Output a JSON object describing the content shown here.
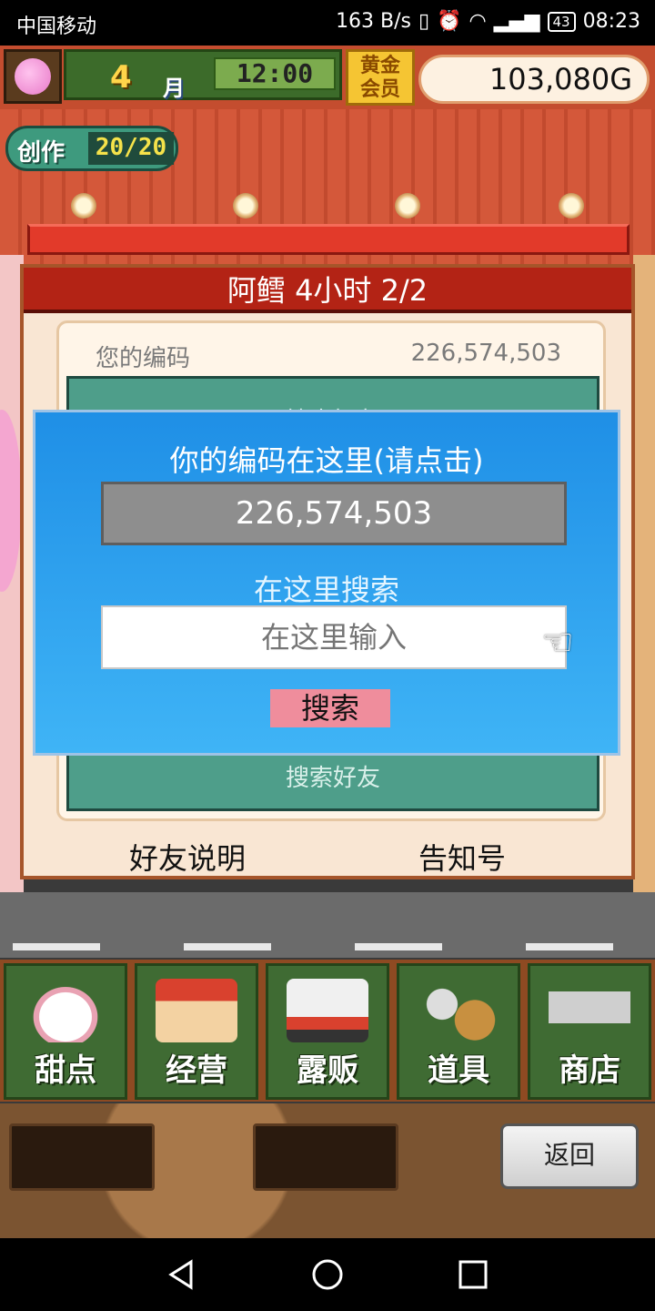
{
  "status_bar": {
    "carrier": "中国移动",
    "speed": "163 B/s",
    "battery": "43",
    "time": "08:23"
  },
  "hud": {
    "month_number": "4",
    "month_label": "月",
    "clock": "12:00",
    "gold_badge_line1": "黄金",
    "gold_badge_line2": "会员",
    "money": "103,080",
    "currency": "G",
    "craft_label": "创作",
    "craft_value": "20/20"
  },
  "panel": {
    "title": "阿鳕  4小时 2/2",
    "your_code_label": "您的编码",
    "your_code_value": "226,574,503",
    "search_friend_text": "搜索好友",
    "friend_help_button": "好友说明",
    "notice_button": "告知号"
  },
  "dialog": {
    "title": "你的编码在这里(请点击)",
    "code": "226,574,503",
    "search_label": "在这里搜索",
    "input_placeholder": "在这里输入",
    "search_button": "搜索"
  },
  "menu": {
    "items": [
      {
        "label": "甜点",
        "icon": "cake-icon"
      },
      {
        "label": "经营",
        "icon": "shop-icon"
      },
      {
        "label": "露贩",
        "icon": "food-truck-icon"
      },
      {
        "label": "道具",
        "icon": "gear-bag-icon"
      },
      {
        "label": "商店",
        "icon": "cart-icon"
      }
    ]
  },
  "bottom": {
    "back_button": "返回"
  },
  "colors": {
    "dialog_blue": "#1f8fe6",
    "title_red": "#b32315",
    "menu_green": "#3f6b33",
    "search_pink": "#ef8d9c"
  }
}
